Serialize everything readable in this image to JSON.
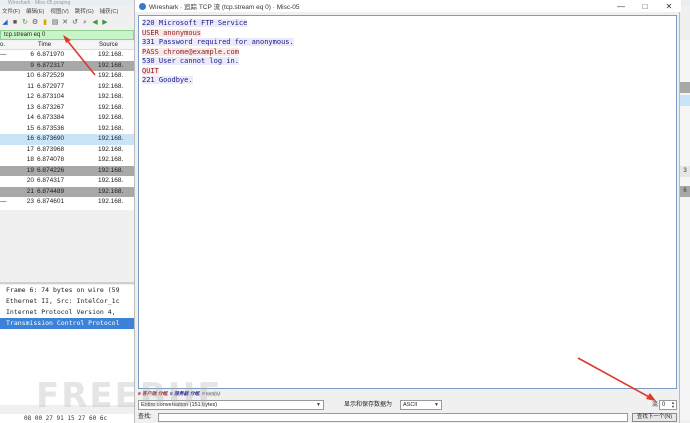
{
  "bg_window": {
    "title": "Wireshark · Misc-05.pcapng",
    "menus": [
      "文件(F)",
      "编辑(E)",
      "视图(V)",
      "跳转(G)",
      "捕获(C)"
    ],
    "filter_value": "tcp.stream eq 0",
    "columns": {
      "no": "o.",
      "time": "Time",
      "source": "Source"
    },
    "packets": [
      {
        "no": "6",
        "time": "6.871970",
        "source": "192.168.",
        "style": "normal",
        "mark": "—"
      },
      {
        "no": "9",
        "time": "6.872317",
        "source": "192.168.",
        "style": "dark",
        "mark": ""
      },
      {
        "no": "10",
        "time": "6.872529",
        "source": "192.168.",
        "style": "normal",
        "mark": ""
      },
      {
        "no": "11",
        "time": "6.872977",
        "source": "192.168.",
        "style": "normal",
        "mark": ""
      },
      {
        "no": "12",
        "time": "6.873104",
        "source": "192.168.",
        "style": "normal",
        "mark": ""
      },
      {
        "no": "13",
        "time": "6.873267",
        "source": "192.168.",
        "style": "normal",
        "mark": ""
      },
      {
        "no": "14",
        "time": "6.873384",
        "source": "192.168.",
        "style": "normal",
        "mark": ""
      },
      {
        "no": "15",
        "time": "6.873536",
        "source": "192.168.",
        "style": "normal",
        "mark": ""
      },
      {
        "no": "16",
        "time": "6.873690",
        "source": "192.168.",
        "style": "sel",
        "mark": ""
      },
      {
        "no": "17",
        "time": "6.873968",
        "source": "192.168.",
        "style": "normal",
        "mark": ""
      },
      {
        "no": "18",
        "time": "6.874078",
        "source": "192.168.",
        "style": "normal",
        "mark": ""
      },
      {
        "no": "19",
        "time": "6.874226",
        "source": "192.168.",
        "style": "dark",
        "mark": ""
      },
      {
        "no": "20",
        "time": "6.874317",
        "source": "192.168.",
        "style": "normal",
        "mark": ""
      },
      {
        "no": "21",
        "time": "6.874489",
        "source": "192.168.",
        "style": "dark",
        "mark": ""
      },
      {
        "no": "23",
        "time": "6.874601",
        "source": "192.168.",
        "style": "normal",
        "mark": "—"
      }
    ],
    "details": [
      {
        "text": "Frame 6: 74 bytes on wire (59",
        "selected": false
      },
      {
        "text": "Ethernet II, Src: IntelCor_1c",
        "selected": false
      },
      {
        "text": "Internet Protocol Version 4,",
        "selected": false
      },
      {
        "text": "Transmission Control Protocol",
        "selected": true
      }
    ],
    "hex": "08 00 27 91 15 27 60 6c",
    "right_marks": [
      {
        "text": "",
        "style": "dark"
      },
      {
        "text": "",
        "style": "blue"
      },
      {
        "text": "3",
        "style": "gray"
      },
      {
        "text": "6",
        "style": "dark"
      }
    ]
  },
  "dialog": {
    "title": "Wireshark · 追踪 TCP 流 (tcp.stream eq 0) · Misc-05",
    "controls": {
      "minimize": "—",
      "maximize": "□",
      "close": "✕"
    },
    "stream": [
      {
        "text": "220 Microsoft FTP Service",
        "side": "server"
      },
      {
        "text": "USER anonymous",
        "side": "client"
      },
      {
        "text": "331 Password required for anonymous.",
        "side": "server"
      },
      {
        "text": "PASS chrome@example.com",
        "side": "client"
      },
      {
        "text": "530 User cannot log in.",
        "side": "server"
      },
      {
        "text": "QUIT",
        "side": "client"
      },
      {
        "text": "221 Goodbye.",
        "side": "server"
      }
    ],
    "stats": {
      "client_pkts": "6 客户端 分组",
      "sep1": ",",
      "server_pkts": "5 服务器 分组",
      "sep2": ",",
      "turns": "9 turn(s).",
      "full": "6 客户端 分组, 5 服务器 分组, 9 turn(s)."
    },
    "conversation_select": "Entire conversation (151 bytes)",
    "show_as_label": "显示和保存数据为",
    "show_as_select": "ASCII",
    "stream_label": "流",
    "stream_value": "0",
    "find_label": "查找:",
    "find_value": "",
    "find_next_label": "查找下一个(N)"
  },
  "watermark": "FREEBUF",
  "colors": {
    "server_text": "#1a1a8c",
    "client_text": "#8c1a1a",
    "filter_bg": "#c8f5c8",
    "selected_detail": "#3c82d8",
    "arrow": "#e0382c"
  }
}
